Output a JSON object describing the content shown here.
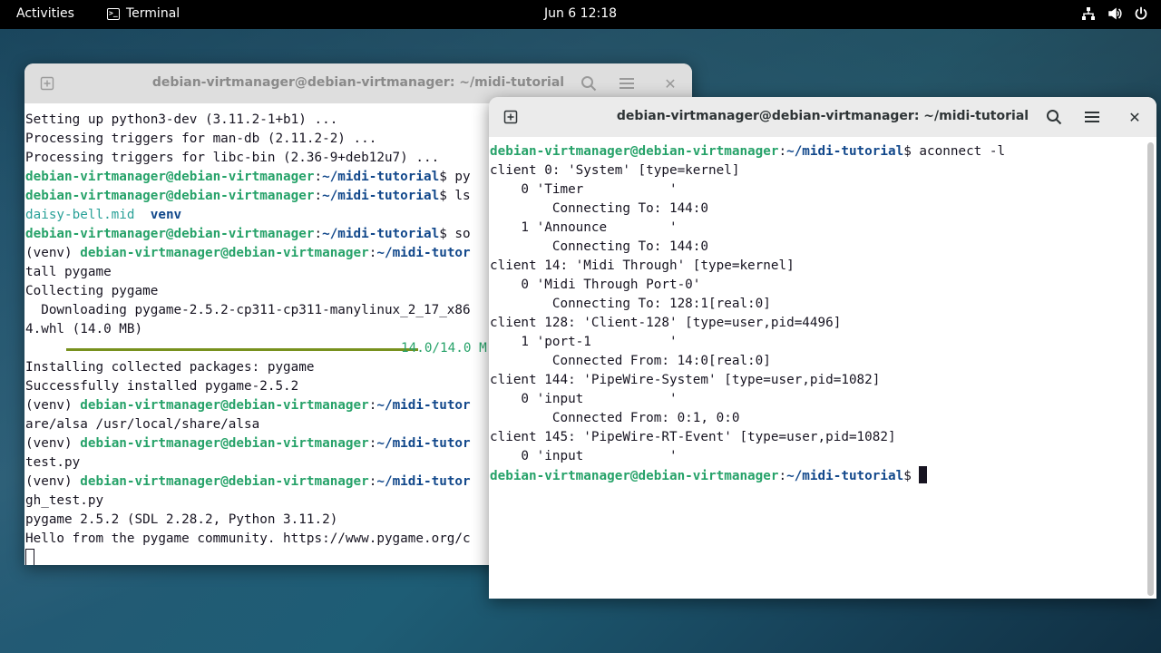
{
  "topbar": {
    "activities": "Activities",
    "app_name": "Terminal",
    "clock": "Jun 6  12:18"
  },
  "icons": [
    "terminal-icon",
    "network-icon",
    "volume-icon",
    "power-icon",
    "new-tab-icon",
    "search-icon",
    "hamburger-menu-icon",
    "close-icon"
  ],
  "back_window": {
    "title": "debian-virtmanager@debian-virtmanager: ~/midi-tutorial",
    "lines": [
      [
        {
          "t": "Setting up python3-dev (3.11.2-1+b1) ..."
        }
      ],
      [
        {
          "t": "Processing triggers for man-db (2.11.2-2) ..."
        }
      ],
      [
        {
          "t": "Processing triggers for libc-bin (2.36-9+deb12u7) ..."
        }
      ],
      [
        {
          "t": "debian-virtmanager@debian-virtmanager",
          "c": "g"
        },
        {
          "t": ":"
        },
        {
          "t": "~/midi-tutorial",
          "c": "b"
        },
        {
          "t": "$ py"
        }
      ],
      [
        {
          "t": "debian-virtmanager@debian-virtmanager",
          "c": "g"
        },
        {
          "t": ":"
        },
        {
          "t": "~/midi-tutorial",
          "c": "b"
        },
        {
          "t": "$ ls"
        }
      ],
      [
        {
          "t": "daisy-bell.mid",
          "c": "dim"
        },
        {
          "t": "  "
        },
        {
          "t": "venv",
          "c": "b"
        }
      ],
      [
        {
          "t": "debian-virtmanager@debian-virtmanager",
          "c": "g"
        },
        {
          "t": ":"
        },
        {
          "t": "~/midi-tutorial",
          "c": "b"
        },
        {
          "t": "$ so"
        }
      ],
      [
        {
          "t": "(venv) "
        },
        {
          "t": "debian-virtmanager@debian-virtmanager",
          "c": "g"
        },
        {
          "t": ":"
        },
        {
          "t": "~/midi-tutor",
          "c": "b"
        }
      ],
      [
        {
          "t": "tall pygame"
        }
      ],
      [
        {
          "t": "Collecting pygame"
        }
      ],
      [
        {
          "t": "  Downloading pygame-2.5.2-cp311-cp311-manylinux_2_17_x86"
        }
      ],
      [
        {
          "t": "4.whl (14.0 MB)"
        }
      ],
      [
        {
          "t": "PROGRESS"
        }
      ],
      [
        {
          "t": "Installing collected packages: pygame"
        }
      ],
      [
        {
          "t": "Successfully installed pygame-2.5.2"
        }
      ],
      [
        {
          "t": "(venv) "
        },
        {
          "t": "debian-virtmanager@debian-virtmanager",
          "c": "g"
        },
        {
          "t": ":"
        },
        {
          "t": "~/midi-tutor",
          "c": "b"
        }
      ],
      [
        {
          "t": "are/alsa /usr/local/share/alsa"
        }
      ],
      [
        {
          "t": "(venv) "
        },
        {
          "t": "debian-virtmanager@debian-virtmanager",
          "c": "g"
        },
        {
          "t": ":"
        },
        {
          "t": "~/midi-tutor",
          "c": "b"
        }
      ],
      [
        {
          "t": "test.py"
        }
      ],
      [
        {
          "t": "(venv) "
        },
        {
          "t": "debian-virtmanager@debian-virtmanager",
          "c": "g"
        },
        {
          "t": ":"
        },
        {
          "t": "~/midi-tutor",
          "c": "b"
        }
      ],
      [
        {
          "t": "gh_test.py"
        }
      ],
      [
        {
          "t": "pygame 2.5.2 (SDL 2.28.2, Python 3.11.2)"
        }
      ],
      [
        {
          "t": "Hello from the pygame community. https://www.pygame.org/c"
        }
      ],
      [
        {
          "t": "CURSOR_HOLLOW"
        }
      ]
    ],
    "progress_text": "14.0/14.0 M",
    "progress_fraction": 1.0
  },
  "front_window": {
    "title": "debian-virtmanager@debian-virtmanager: ~/midi-tutorial",
    "lines": [
      [
        {
          "t": "debian-virtmanager@debian-virtmanager",
          "c": "g"
        },
        {
          "t": ":"
        },
        {
          "t": "~/midi-tutorial",
          "c": "b"
        },
        {
          "t": "$ aconnect -l"
        }
      ],
      [
        {
          "t": "client 0: 'System' [type=kernel]"
        }
      ],
      [
        {
          "t": "    0 'Timer           '"
        }
      ],
      [
        {
          "t": "        Connecting To: 144:0"
        }
      ],
      [
        {
          "t": "    1 'Announce        '"
        }
      ],
      [
        {
          "t": "        Connecting To: 144:0"
        }
      ],
      [
        {
          "t": "client 14: 'Midi Through' [type=kernel]",
          "hl": true
        }
      ],
      [
        {
          "t": "    0 'Midi Through Port-0'",
          "hl": true
        }
      ],
      [
        {
          "t": "        Connecting To: 128:1[real:0]",
          "hl": true
        }
      ],
      [
        {
          "t": "client 128: 'Client-128' [type=user,pid=4496]"
        }
      ],
      [
        {
          "t": "    1 'port-1          '"
        }
      ],
      [
        {
          "t": "        Connected From: 14:0[real:0]"
        }
      ],
      [
        {
          "t": "client 144: 'PipeWire-System' [type=user,pid=1082]"
        }
      ],
      [
        {
          "t": "    0 'input           '"
        }
      ],
      [
        {
          "t": "        Connected From: 0:1, 0:0"
        }
      ],
      [
        {
          "t": "client 145: 'PipeWire-RT-Event' [type=user,pid=1082]"
        }
      ],
      [
        {
          "t": "    0 'input           '"
        }
      ],
      [
        {
          "t": "debian-virtmanager@debian-virtmanager",
          "c": "g"
        },
        {
          "t": ":"
        },
        {
          "t": "~/midi-tutorial",
          "c": "b"
        },
        {
          "t": "$ "
        },
        {
          "t": "CURSOR"
        }
      ]
    ]
  }
}
